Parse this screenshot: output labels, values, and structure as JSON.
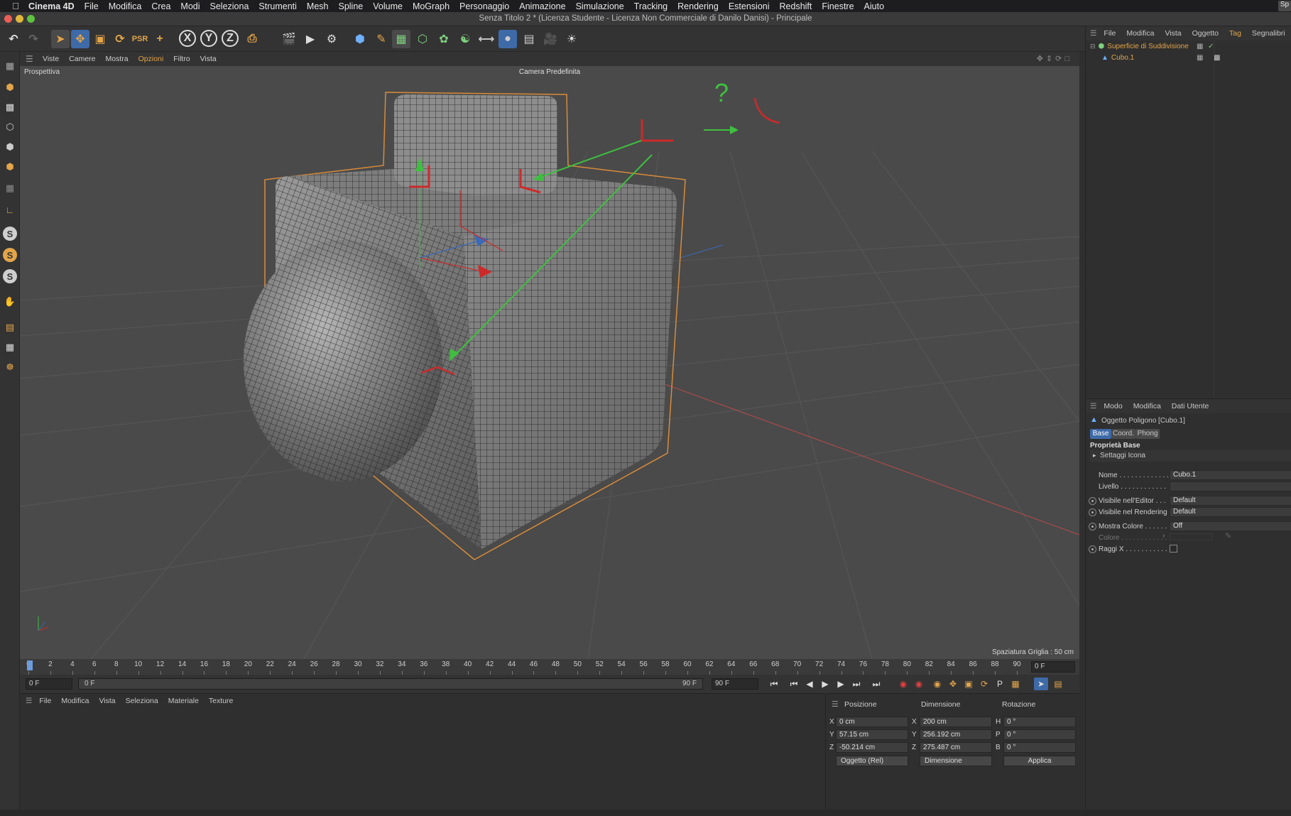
{
  "menubar": {
    "app_name": "Cinema 4D",
    "items": [
      "File",
      "Modifica",
      "Crea",
      "Modi",
      "Seleziona",
      "Strumenti",
      "Mesh",
      "Spline",
      "Volume",
      "MoGraph",
      "Personaggio",
      "Animazione",
      "Simulazione",
      "Tracking",
      "Rendering",
      "Estensioni",
      "Redshift",
      "Finestre",
      "Aiuto"
    ],
    "right_label": "Sp"
  },
  "window": {
    "title": "Senza Titolo 2 * (Licenza Studente - Licenza Non Commerciale di Danilo Danisi) - Principale"
  },
  "toolbar": {
    "axis_x": "X",
    "axis_y": "Y",
    "axis_z": "Z"
  },
  "viewport": {
    "menu": [
      "Viste",
      "Camere",
      "Mostra",
      "Opzioni",
      "Filtro",
      "Vista"
    ],
    "active_menu": "Opzioni",
    "view_label": "Prospettiva",
    "camera_label": "Camera Predefinita",
    "grid_label": "Spaziatura Griglia : 50 cm",
    "annotation_question": "?"
  },
  "timeline": {
    "ticks": [
      "0",
      "2",
      "4",
      "6",
      "8",
      "10",
      "12",
      "14",
      "16",
      "18",
      "20",
      "22",
      "24",
      "26",
      "28",
      "30",
      "32",
      "34",
      "36",
      "38",
      "40",
      "42",
      "44",
      "46",
      "48",
      "50",
      "52",
      "54",
      "56",
      "58",
      "60",
      "62",
      "64",
      "66",
      "68",
      "70",
      "72",
      "74",
      "76",
      "78",
      "80",
      "82",
      "84",
      "86",
      "88",
      "90"
    ],
    "current_frame": "0 F",
    "start_field": "0 F",
    "range_start": "0 F",
    "range_end": "90 F",
    "end_field": "90 F"
  },
  "material_manager": {
    "menu": [
      "File",
      "Modifica",
      "Vista",
      "Seleziona",
      "Materiale",
      "Texture"
    ]
  },
  "coordinates": {
    "headers": {
      "position": "Posizione",
      "size": "Dimensione",
      "rotation": "Rotazione"
    },
    "rows": [
      {
        "axis": "X",
        "pos": "0 cm",
        "size_axis": "X",
        "size": "200 cm",
        "rot_axis": "H",
        "rot": "0 °"
      },
      {
        "axis": "Y",
        "pos": "57.15 cm",
        "size_axis": "Y",
        "size": "256.192 cm",
        "rot_axis": "P",
        "rot": "0 °"
      },
      {
        "axis": "Z",
        "pos": "-50.214 cm",
        "size_axis": "Z",
        "size": "275.487 cm",
        "rot_axis": "B",
        "rot": "0 °"
      }
    ],
    "mode_dropdown": "Oggetto (Rel)",
    "size_dropdown": "Dimensione",
    "apply_label": "Applica"
  },
  "object_manager": {
    "menu": [
      "File",
      "Modifica",
      "Vista",
      "Oggetto",
      "Tag",
      "Segnalibri"
    ],
    "objects": [
      {
        "name": "Superficie di Suddivisione"
      },
      {
        "name": "Cubo.1"
      }
    ]
  },
  "attribute_manager": {
    "menu": [
      "Modo",
      "Modifica",
      "Dati Utente"
    ],
    "object_title": "Oggetto Poligono [Cubo.1]",
    "tabs": [
      "Base",
      "Coord.",
      "Phong"
    ],
    "section": "Proprietà Base",
    "subsection": "Settaggi Icona",
    "fields": {
      "name_label": "Nome . . . . . . . . . . . . .",
      "name_value": "Cubo.1",
      "level_label": "Livello . . . . . . . . . . . .",
      "vis_editor_label": "Visibile nell'Editor . . .",
      "vis_editor_value": "Default",
      "vis_render_label": "Visibile nel Rendering",
      "vis_render_value": "Default",
      "show_color_label": "Mostra Colore . . . . . .",
      "show_color_value": "Off",
      "color_label": "Colore . . . . . . . . . . . .",
      "xray_label": "Raggi X . . . . . . . . . . ."
    }
  },
  "colors": {
    "accent": "#e3a54a",
    "selection_orange": "#d98b3a",
    "annotation_green": "#3fbf3f",
    "annotation_red": "#cc2a2a",
    "mesh_gray": "#8e8e8e"
  }
}
